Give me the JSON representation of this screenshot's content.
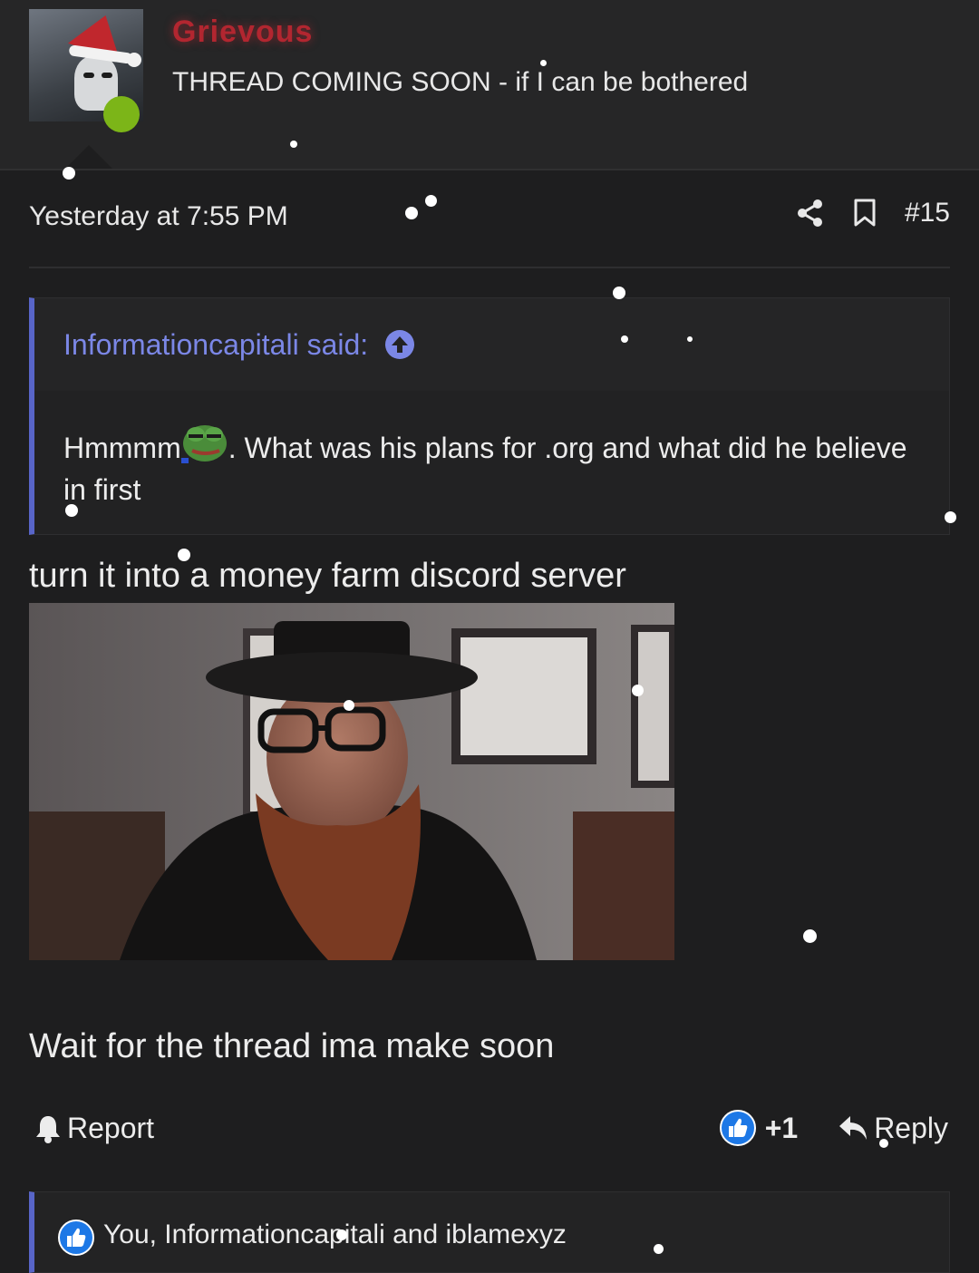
{
  "user": {
    "name": "Grievous",
    "title": "THREAD COMING SOON - if I can be bothered",
    "status_color": "#7cb518"
  },
  "post": {
    "timestamp": "Yesterday at 7:55 PM",
    "number": "#15",
    "icons": [
      "share-icon",
      "bookmark-icon"
    ],
    "quote": {
      "author": "Informationcapitali said:",
      "text_before_emoji": "Hmmmm",
      "emoji": "pepe-emoji",
      "text_after_emoji": ". What was his plans for .org and what did he believe in first"
    },
    "body_line1": "turn it into a money farm discord server",
    "body_line2": "Wait for the thread ima make soon"
  },
  "actions": {
    "report": "Report",
    "reaction_count": "+1",
    "reply": "Reply"
  },
  "reactions": {
    "text": "You, Informationcapitali and iblamexyz"
  },
  "colors": {
    "background": "#1e1e1f",
    "accent": "#5865c8",
    "username": "#b22630",
    "like_blue": "#1d78e6"
  }
}
